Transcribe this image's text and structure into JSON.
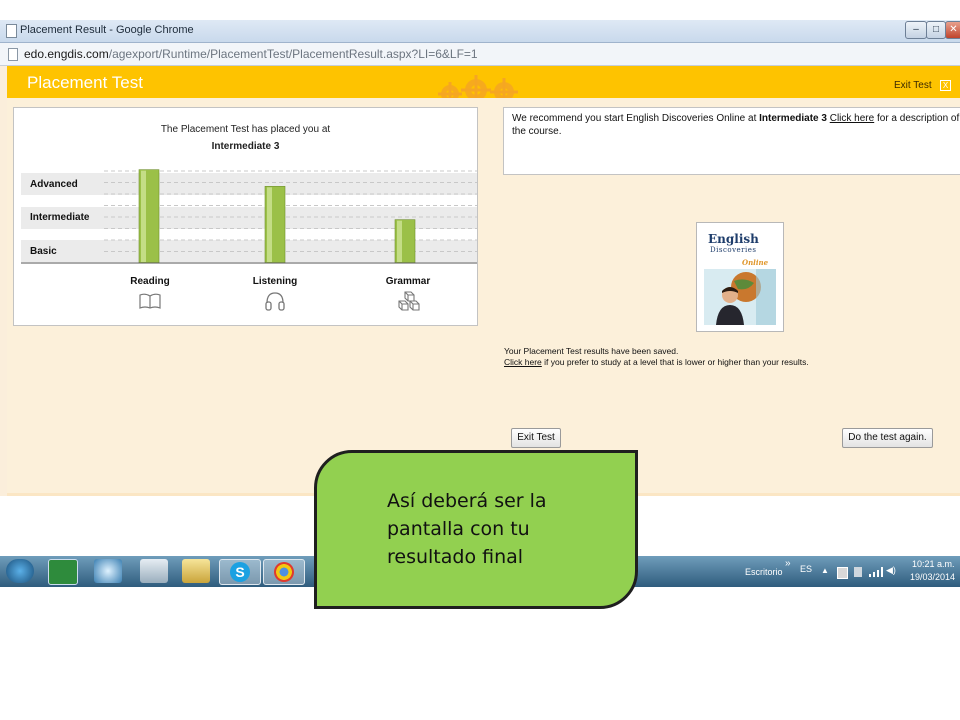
{
  "browser": {
    "window_title": "Placement Result - Google Chrome",
    "url_host": "edo.engdis.com",
    "url_path": "/agexport/Runtime/PlacementTest/PlacementResult.aspx?LI=6&LF=1"
  },
  "header": {
    "title": "Placement Test",
    "exit_label": "Exit Test",
    "close_glyph": "X",
    "color": "#fec300"
  },
  "results": {
    "intro": "The Placement Test has placed you at",
    "level": "Intermediate 3",
    "levels": [
      "Advanced",
      "Intermediate",
      "Basic"
    ]
  },
  "chart_data": {
    "type": "bar",
    "categories": [
      "Reading",
      "Listening",
      "Grammar"
    ],
    "y_categories": [
      "Basic",
      "Intermediate",
      "Advanced"
    ],
    "values": [
      2.8,
      2.3,
      1.3
    ],
    "ylim": [
      0,
      3
    ],
    "grid": true,
    "bar_color": "#9bc048"
  },
  "skill_icons": [
    "book-icon",
    "headphones-icon",
    "blocks-icon"
  ],
  "recommendation": {
    "text_before": "We recommend you start English Discoveries Online at ",
    "level": "Intermediate 3",
    "link": "Click here",
    "text_after": " for a description of the course."
  },
  "book": {
    "line1": "English",
    "line2": "Discoveries",
    "line3": "Online"
  },
  "saved": {
    "line1": "Your Placement Test results have been saved.",
    "link": "Click here",
    "line2_rest": " if you prefer to study at a level that is lower or higher than your results."
  },
  "buttons": {
    "exit": "Exit Test",
    "again": "Do the test again."
  },
  "taskbar": {
    "desktop": "Escritorio",
    "chevron": "»",
    "lang": "ES",
    "time": "10:21 a.m.",
    "date": "19/03/2014"
  },
  "callout": {
    "text": "Así deberá ser la pantalla con tu resultado final",
    "color": "#92d050"
  }
}
